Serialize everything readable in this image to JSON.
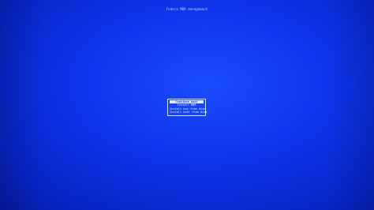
{
  "header": {
    "title": "Fedora MBR management"
  },
  "menu": {
    "items": [
      {
        "label": "Continue boot",
        "selected": true
      },
      {
        "label": "Install MBR",
        "selected": false
      },
      {
        "label": "Install key from disk",
        "selected": false
      },
      {
        "label": "Install boot from disk",
        "selected": false
      }
    ]
  },
  "colors": {
    "background": "#0f36ee",
    "text": "#e8eeff",
    "highlight_bg": "#e8eeff",
    "highlight_text": "#1030d8"
  }
}
